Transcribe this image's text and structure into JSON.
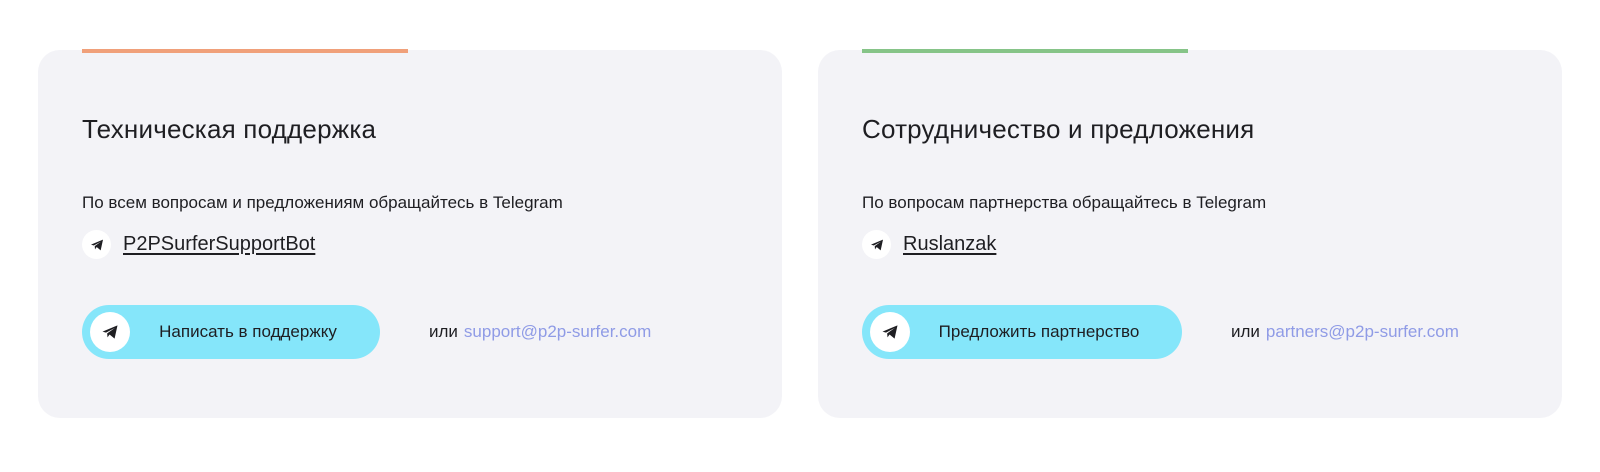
{
  "colors": {
    "card_bg": "#f3f3f7",
    "accent_support": "#f0a07a",
    "accent_partner": "#86c488",
    "button_bg": "#85e6fa",
    "email_link": "#8f9be6",
    "text": "#1e1e22"
  },
  "cards": [
    {
      "title": "Техническая поддержка",
      "description": "По всем вопросам и предложениям обращайтесь в Telegram",
      "telegram_icon": "telegram-icon",
      "telegram_handle": "P2PSurferSupportBot",
      "button_label": "Написать в поддержку",
      "button_icon": "telegram-icon",
      "or_text": "или",
      "email": "support@p2p-surfer.com"
    },
    {
      "title": "Сотрудничество и предложения",
      "description": "По вопросам партнерства обращайтесь в Telegram",
      "telegram_icon": "telegram-icon",
      "telegram_handle": "Ruslanzak",
      "button_label": "Предложить партнерство",
      "button_icon": "telegram-icon",
      "or_text": "или",
      "email": "partners@p2p-surfer.com"
    }
  ]
}
